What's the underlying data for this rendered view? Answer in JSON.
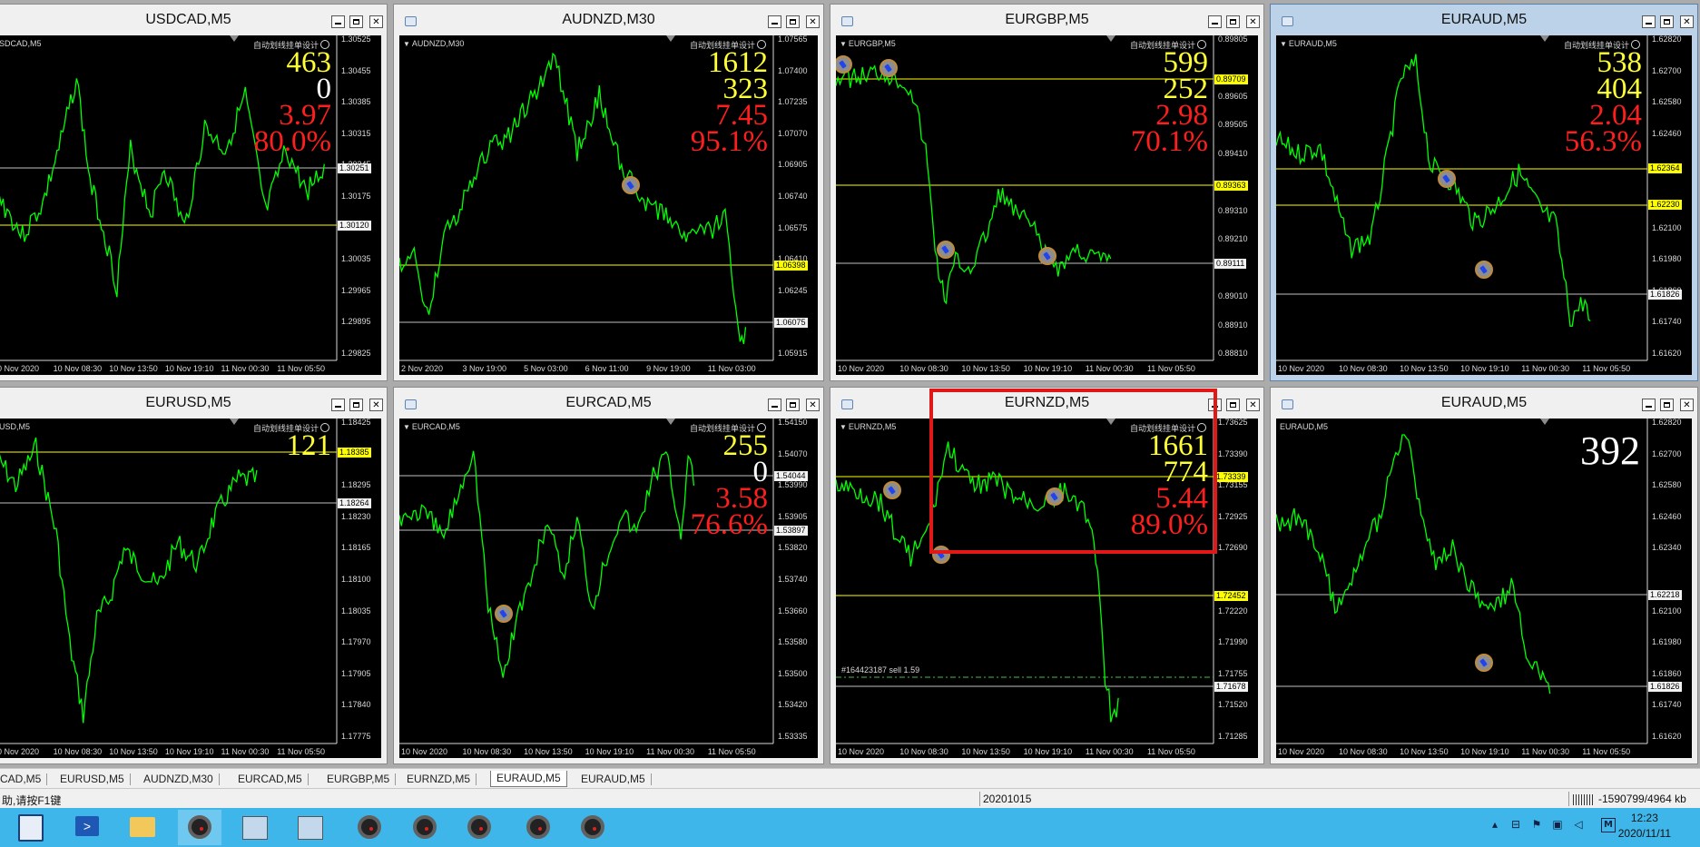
{
  "charts": [
    {
      "title": "USDCAD,M5",
      "symbol_label": "SDCAD,M5",
      "ea_label": "自动划线挂单设计",
      "stats": [
        {
          "t": "463",
          "c": "y"
        },
        {
          "t": "0",
          "c": "w"
        },
        {
          "t": "3.97",
          "c": "r"
        },
        {
          "t": "80.0%",
          "c": "r"
        }
      ],
      "price_ticks": [
        "1.30525",
        "1.30455",
        "1.30385",
        "1.30315",
        "1.30245",
        "1.30175",
        "1.30105",
        "1.30035",
        "1.29965",
        "1.29895",
        "1.29825"
      ],
      "price_labels": [
        {
          "price": "1.30251",
          "style": "bw"
        },
        {
          "price": "1.30120",
          "style": "bw"
        }
      ],
      "time_ticks": [
        "0 Nov 2020",
        "10 Nov 08:30",
        "10 Nov 13:50",
        "10 Nov 19:10",
        "11 Nov 00:30",
        "11 Nov 05:50"
      ],
      "orders": []
    },
    {
      "title": "AUDNZD,M30",
      "symbol_label": "AUDNZD,M30",
      "ea_label": "自动划线挂单设计",
      "stats": [
        {
          "t": "1612",
          "c": "y"
        },
        {
          "t": "323",
          "c": "y"
        },
        {
          "t": "7.45",
          "c": "r"
        },
        {
          "t": "95.1%",
          "c": "r"
        }
      ],
      "price_ticks": [
        "1.07565",
        "1.07400",
        "1.07235",
        "1.07070",
        "1.06905",
        "1.06740",
        "1.06575",
        "1.06410",
        "1.06245",
        "1.06080",
        "1.05915"
      ],
      "price_labels": [
        {
          "price": "1.06398",
          "style": "b"
        },
        {
          "price": "1.06075",
          "style": "bw"
        }
      ],
      "time_ticks": [
        "2 Nov 2020",
        "3 Nov 19:00",
        "5 Nov 03:00",
        "6 Nov 11:00",
        "9 Nov 19:00",
        "11 Nov 03:00"
      ],
      "orders": []
    },
    {
      "title": "EURGBP,M5",
      "symbol_label": "EURGBP,M5",
      "ea_label": "自动划线挂单设计",
      "stats": [
        {
          "t": "599",
          "c": "y"
        },
        {
          "t": "252",
          "c": "y"
        },
        {
          "t": "2.98",
          "c": "r"
        },
        {
          "t": "70.1%",
          "c": "r"
        }
      ],
      "price_ticks": [
        "0.89805",
        "",
        "0.89605",
        "0.89505",
        "0.89410",
        "",
        "0.89310",
        "0.89210",
        "",
        "0.89010",
        "0.88910",
        "0.88810"
      ],
      "price_labels": [
        {
          "price": "0.89709",
          "style": "b"
        },
        {
          "price": "0.89363",
          "style": "b"
        },
        {
          "price": "0.89111",
          "style": "bw"
        }
      ],
      "time_ticks": [
        "10 Nov 2020",
        "10 Nov 08:30",
        "10 Nov 13:50",
        "10 Nov 19:10",
        "11 Nov 00:30",
        "11 Nov 05:50"
      ],
      "orders": []
    },
    {
      "title": "EURAUD,M5",
      "symbol_label": "EURAUD,M5",
      "ea_label": "自动划线挂单设计",
      "stats": [
        {
          "t": "538",
          "c": "y"
        },
        {
          "t": "404",
          "c": "y"
        },
        {
          "t": "2.04",
          "c": "r"
        },
        {
          "t": "56.3%",
          "c": "r"
        }
      ],
      "price_ticks": [
        "1.62820",
        "1.62700",
        "1.62580",
        "1.62460",
        "",
        "",
        "1.62100",
        "1.61980",
        "1.61860",
        "1.61740",
        "1.61620"
      ],
      "price_labels": [
        {
          "price": "1.62364",
          "style": "b"
        },
        {
          "price": "1.62230",
          "style": "b"
        },
        {
          "price": "1.61826",
          "style": "bw"
        }
      ],
      "time_ticks": [
        "10 Nov 2020",
        "10 Nov 08:30",
        "10 Nov 13:50",
        "10 Nov 19:10",
        "11 Nov 00:30",
        "11 Nov 05:50"
      ],
      "orders": []
    },
    {
      "title": "EURUSD,M5",
      "symbol_label": "USD,M5",
      "ea_label": "自动划线挂单设计",
      "stats": [
        {
          "t": "121",
          "c": "y"
        }
      ],
      "price_ticks": [
        "1.18425",
        "1.18360",
        "1.18295",
        "1.18230",
        "1.18165",
        "1.18100",
        "1.18035",
        "1.17970",
        "1.17905",
        "1.17840",
        "1.17775"
      ],
      "price_labels": [
        {
          "price": "1.18385",
          "style": "b"
        },
        {
          "price": "1.18264",
          "style": "bw"
        }
      ],
      "time_ticks": [
        "0 Nov 2020",
        "10 Nov 08:30",
        "10 Nov 13:50",
        "10 Nov 19:10",
        "11 Nov 00:30",
        "11 Nov 05:50"
      ],
      "orders": []
    },
    {
      "title": "EURCAD,M5",
      "symbol_label": "EURCAD,M5",
      "ea_label": "自动划线挂单设计",
      "stats": [
        {
          "t": "255",
          "c": "y"
        },
        {
          "t": "0",
          "c": "w"
        },
        {
          "t": "3.58",
          "c": "r"
        },
        {
          "t": "76.6%",
          "c": "r"
        }
      ],
      "price_ticks": [
        "1.54150",
        "1.54070",
        "1.53990",
        "1.53905",
        "1.53820",
        "1.53740",
        "1.53660",
        "1.53580",
        "1.53500",
        "1.53420",
        "1.53335"
      ],
      "price_labels": [
        {
          "price": "1.54044",
          "style": "bw"
        },
        {
          "price": "1.53897",
          "style": "bw"
        }
      ],
      "time_ticks": [
        "10 Nov 2020",
        "10 Nov 08:30",
        "10 Nov 13:50",
        "10 Nov 19:10",
        "11 Nov 00:30",
        "11 Nov 05:50"
      ],
      "orders": []
    },
    {
      "title": "EURNZD,M5",
      "symbol_label": "EURNZD,M5",
      "ea_label": "自动划线挂单设计",
      "stats": [
        {
          "t": "1661",
          "c": "y"
        },
        {
          "t": "774",
          "c": "y"
        },
        {
          "t": "5.44",
          "c": "r"
        },
        {
          "t": "89.0%",
          "c": "r"
        }
      ],
      "price_ticks": [
        "1.73625",
        "1.73390",
        "1.73155",
        "1.72925",
        "1.72690",
        "",
        "1.72220",
        "1.71990",
        "1.71755",
        "1.71520",
        "1.71285"
      ],
      "price_labels": [
        {
          "price": "1.73339",
          "style": "b"
        },
        {
          "price": "1.72452",
          "style": "b"
        },
        {
          "price": "1.71678",
          "style": "bw"
        }
      ],
      "time_ticks": [
        "10 Nov 2020",
        "10 Nov 08:30",
        "10 Nov 13:50",
        "10 Nov 19:10",
        "11 Nov 00:30",
        "11 Nov 05:50"
      ],
      "orders": [
        {
          "text": "#164423187 sell 1.59"
        }
      ]
    },
    {
      "title": "EURAUD,M5",
      "symbol_label": "EURAUD,M5",
      "ea_label": "",
      "stats": [],
      "big": "392",
      "price_ticks": [
        "1.62820",
        "1.62700",
        "1.62580",
        "1.62460",
        "1.62340",
        "",
        "1.62100",
        "1.61980",
        "1.61860",
        "1.61740",
        "1.61620"
      ],
      "price_labels": [
        {
          "price": "1.62218",
          "style": "bw"
        },
        {
          "price": "1.61826",
          "style": "bw"
        }
      ],
      "time_ticks": [
        "10 Nov 2020",
        "10 Nov 08:30",
        "10 Nov 13:50",
        "10 Nov 19:10",
        "11 Nov 00:30",
        "11 Nov 05:50"
      ],
      "orders": []
    }
  ],
  "tabs": [
    "CAD,M5",
    "EURUSD,M5",
    "AUDNZD,M30",
    "EURCAD,M5",
    "EURGBP,M5",
    "EURNZD,M5",
    "EURAUD,M5",
    "EURAUD,M5"
  ],
  "active_tab": 6,
  "status": {
    "help": "助,请按F1键",
    "profile": "20201015",
    "traffic": "-1590799/4964 kb"
  },
  "clock": {
    "time": "12:23",
    "date": "2020/11/11"
  },
  "colors": {
    "price_line": "#00ff00",
    "level_line": "#ffff00",
    "grid_line": "#c0c0c0",
    "highlight": "#e01818"
  },
  "icons": {
    "start": "server-manager-icon",
    "ps": "powershell-icon",
    "folder": "file-explorer-icon",
    "app": "metatrader-icon"
  }
}
